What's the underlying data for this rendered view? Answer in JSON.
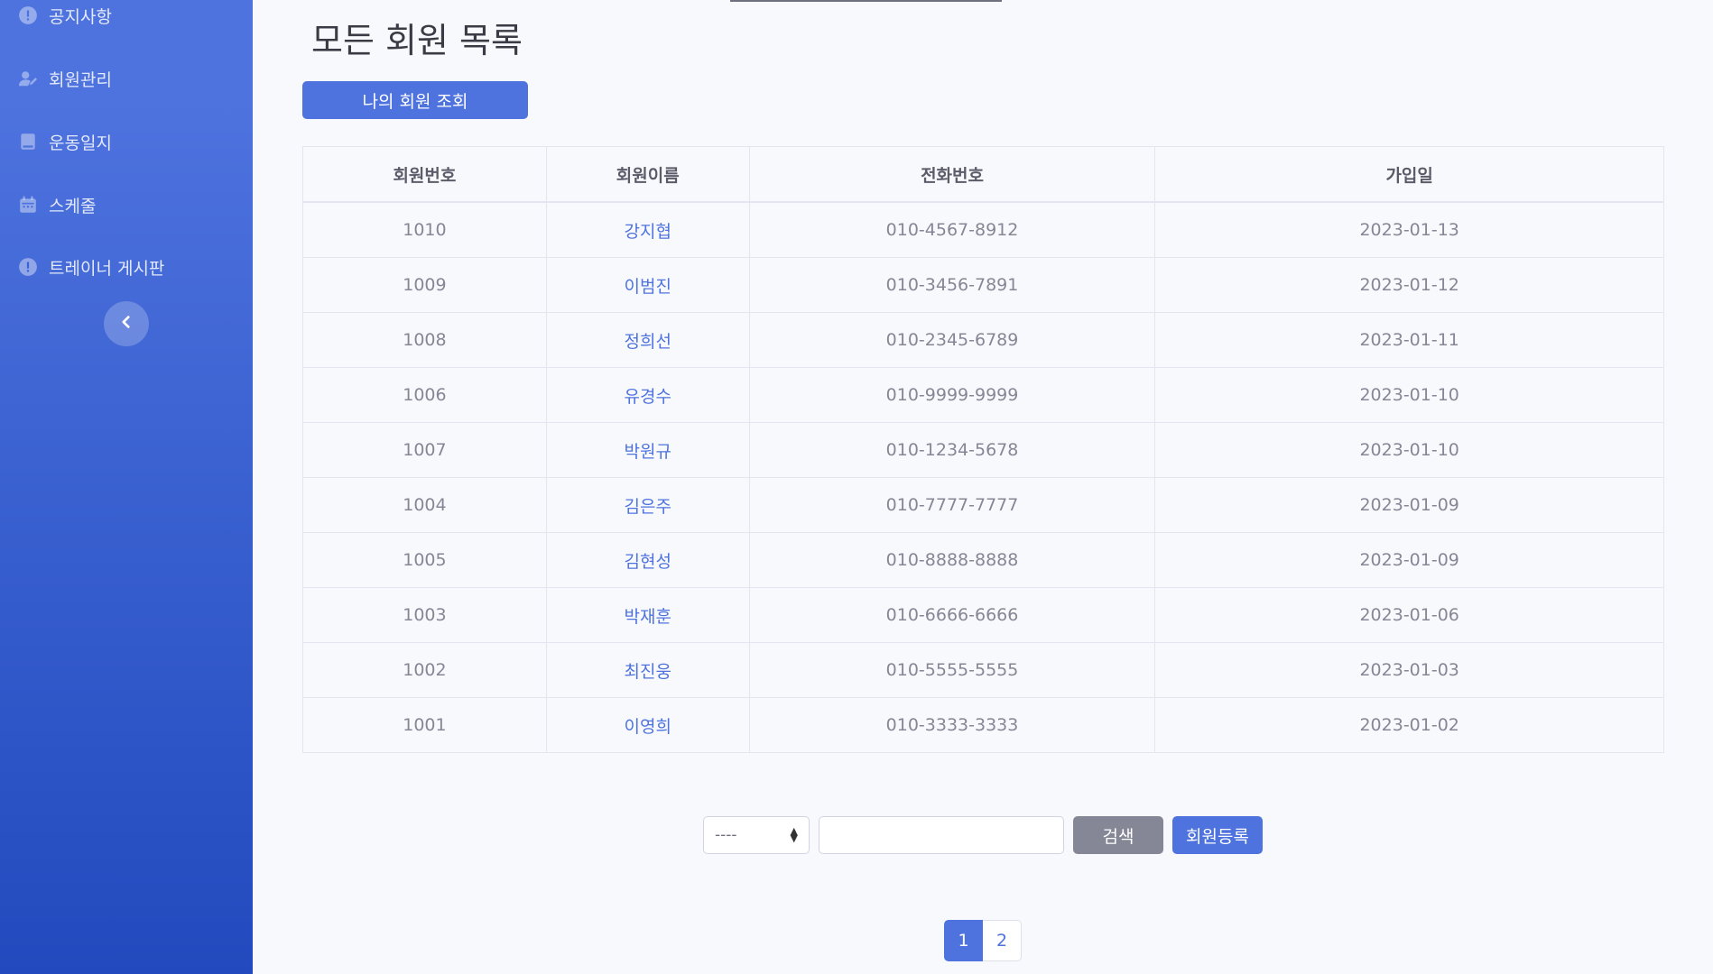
{
  "sidebar": {
    "items": [
      {
        "label": "공지사항",
        "icon": "exclamation-circle-icon"
      },
      {
        "label": "회원관리",
        "icon": "user-edit-icon"
      },
      {
        "label": "운동일지",
        "icon": "book-icon"
      },
      {
        "label": "스케줄",
        "icon": "calendar-icon"
      },
      {
        "label": "트레이너 게시판",
        "icon": "exclamation-circle-icon"
      }
    ],
    "toggle_icon": "chevron-left-icon"
  },
  "page": {
    "title": "모든 회원 목록",
    "my_members_button": "나의 회원 조회"
  },
  "table": {
    "headers": [
      "회원번호",
      "회원이름",
      "전화번호",
      "가입일"
    ],
    "rows": [
      [
        "1010",
        "강지협",
        "010-4567-8912",
        "2023-01-13"
      ],
      [
        "1009",
        "이범진",
        "010-3456-7891",
        "2023-01-12"
      ],
      [
        "1008",
        "정희선",
        "010-2345-6789",
        "2023-01-11"
      ],
      [
        "1006",
        "유경수",
        "010-9999-9999",
        "2023-01-10"
      ],
      [
        "1007",
        "박원규",
        "010-1234-5678",
        "2023-01-10"
      ],
      [
        "1004",
        "김은주",
        "010-7777-7777",
        "2023-01-09"
      ],
      [
        "1005",
        "김현성",
        "010-8888-8888",
        "2023-01-09"
      ],
      [
        "1003",
        "박재훈",
        "010-6666-6666",
        "2023-01-06"
      ],
      [
        "1002",
        "최진웅",
        "010-5555-5555",
        "2023-01-03"
      ],
      [
        "1001",
        "이영희",
        "010-3333-3333",
        "2023-01-02"
      ]
    ]
  },
  "search": {
    "select_value": "----",
    "input_value": "",
    "search_button": "검색",
    "register_button": "회원등록"
  },
  "pagination": {
    "pages": [
      "1",
      "2"
    ],
    "active": "1"
  },
  "colors": {
    "primary": "#4e73df",
    "secondary": "#858796",
    "sidebar_gradient_start": "#4e73df",
    "sidebar_gradient_end": "#224abe"
  }
}
